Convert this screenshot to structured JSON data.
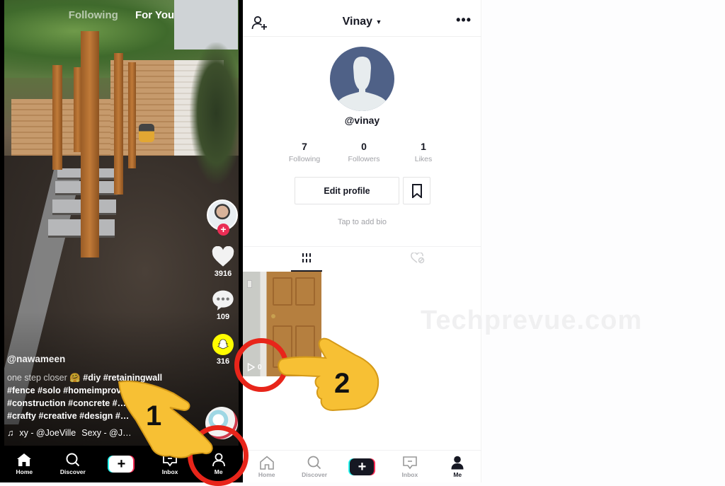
{
  "feed": {
    "tabs": [
      {
        "label": "Following",
        "active": false
      },
      {
        "label": "For You",
        "active": true
      }
    ],
    "creator": {
      "username": "@nawameen",
      "follow_icon": "plus-icon"
    },
    "actions": {
      "likes": "3916",
      "comments": "109",
      "shares": "316"
    },
    "caption": {
      "description": "one step closer 🤗",
      "hashtags_line1": "#diy #retainingwall",
      "hashtags_line2": "#fence #solo #homeimprove…",
      "hashtags_line3": "#construction #concrete #…",
      "hashtags_line4": "#crafty #creative #design #…"
    },
    "music": {
      "icon": "music-note-icon",
      "text1": "xy - @JoeVille",
      "text2": "Sexy - @J…"
    },
    "nav": [
      {
        "label": "Home",
        "icon": "home-icon",
        "active": true
      },
      {
        "label": "Discover",
        "icon": "search-icon",
        "active": false
      },
      {
        "label": "",
        "icon": "create-plus-icon",
        "active": false
      },
      {
        "label": "Inbox",
        "icon": "inbox-icon",
        "active": false,
        "notification_dot": true
      },
      {
        "label": "Me",
        "icon": "person-icon",
        "active": false
      }
    ]
  },
  "profile": {
    "header": {
      "title": "Vinay",
      "dropdown_icon": "caret-down-icon",
      "left_icon": "add-friend-icon",
      "right_icon": "more-icon"
    },
    "handle": "@vinay",
    "stats": [
      {
        "value": "7",
        "label": "Following"
      },
      {
        "value": "0",
        "label": "Followers"
      },
      {
        "value": "1",
        "label": "Likes"
      }
    ],
    "edit_profile_label": "Edit profile",
    "bookmark_icon": "bookmark-icon",
    "bio_placeholder": "Tap to add bio",
    "content_tabs": [
      {
        "icon": "videos-grid-icon",
        "active": true
      },
      {
        "icon": "liked-hidden-icon",
        "active": false
      }
    ],
    "videos": [
      {
        "views": "0"
      }
    ],
    "nav": [
      {
        "label": "Home",
        "icon": "home-icon",
        "active": false
      },
      {
        "label": "Discover",
        "icon": "search-icon",
        "active": false
      },
      {
        "label": "",
        "icon": "create-plus-icon",
        "active": false
      },
      {
        "label": "Inbox",
        "icon": "inbox-icon",
        "active": false
      },
      {
        "label": "Me",
        "icon": "person-icon",
        "active": true
      }
    ]
  },
  "annotations": {
    "step1": "1",
    "step2": "2",
    "ring_color": "#e8251a",
    "hand_color": "#f7c034"
  },
  "watermark": "Techprevue.com"
}
